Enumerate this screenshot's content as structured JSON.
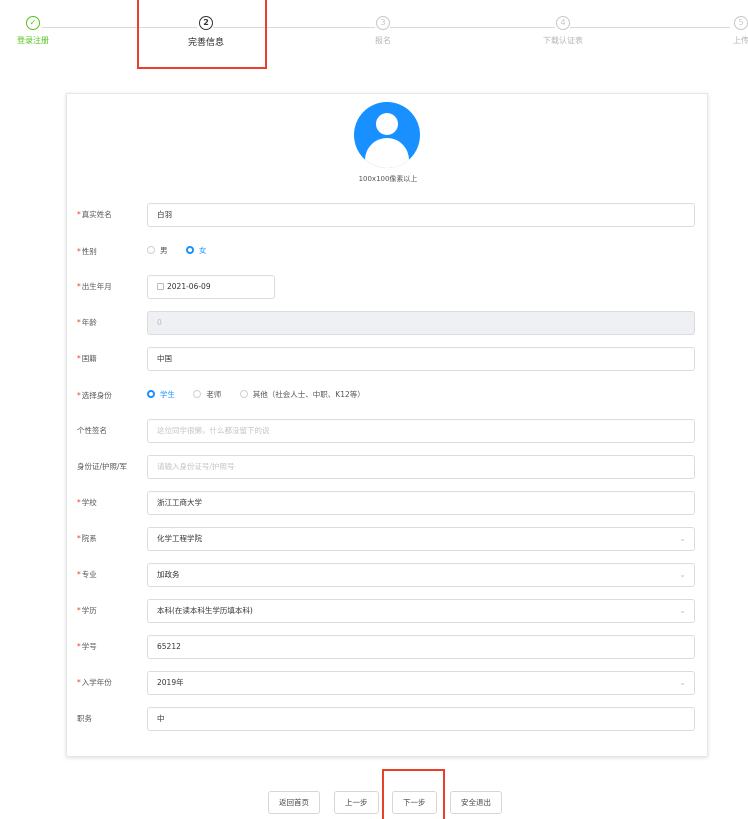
{
  "steps": [
    {
      "label": "登录注册",
      "index": "",
      "status": "done"
    },
    {
      "label": "完善信息",
      "index": "2",
      "status": "active"
    },
    {
      "label": "报名",
      "index": "3",
      "status": "pending"
    },
    {
      "label": "下载认证表",
      "index": "4",
      "status": "pending"
    },
    {
      "label": "上传",
      "index": "5",
      "status": "pending"
    }
  ],
  "avatar": {
    "hint": "100x100像素以上"
  },
  "form": {
    "name": {
      "label": "真实姓名",
      "value": "白羽"
    },
    "gender": {
      "label": "性别",
      "options": [
        "男",
        "女"
      ],
      "selected": "女"
    },
    "birth": {
      "label": "出生年月",
      "value": "2021-06-09"
    },
    "age": {
      "label": "年龄",
      "value": "0"
    },
    "nationality": {
      "label": "国籍",
      "value": "中国"
    },
    "identity": {
      "label": "选择身份",
      "options": [
        "学生",
        "老师",
        "其他（社会人士、中职、K12等）"
      ],
      "selected": "学生"
    },
    "signature": {
      "label": "个性签名",
      "placeholder": "这位同学很懒，什么都没留下的说"
    },
    "idcard": {
      "label": "身份证/护照/军",
      "placeholder": "请输入身份证号/护照号"
    },
    "school": {
      "label": "学校",
      "value": "浙江工商大学"
    },
    "department": {
      "label": "院系",
      "value": "化学工程学院"
    },
    "major": {
      "label": "专业",
      "value": "加政务"
    },
    "education": {
      "label": "学历",
      "value": "本科(在读本科生学历填本科)"
    },
    "student_id": {
      "label": "学号",
      "value": "65212"
    },
    "enroll_year": {
      "label": "入学年份",
      "value": "2019年"
    },
    "position": {
      "label": "职务",
      "value": "中"
    }
  },
  "buttons": {
    "home": "返回首页",
    "prev": "上一步",
    "next": "下一步",
    "logout": "安全退出"
  },
  "colors": {
    "primary": "#1890ff",
    "success": "#52c41a",
    "highlight": "#e8402a"
  }
}
